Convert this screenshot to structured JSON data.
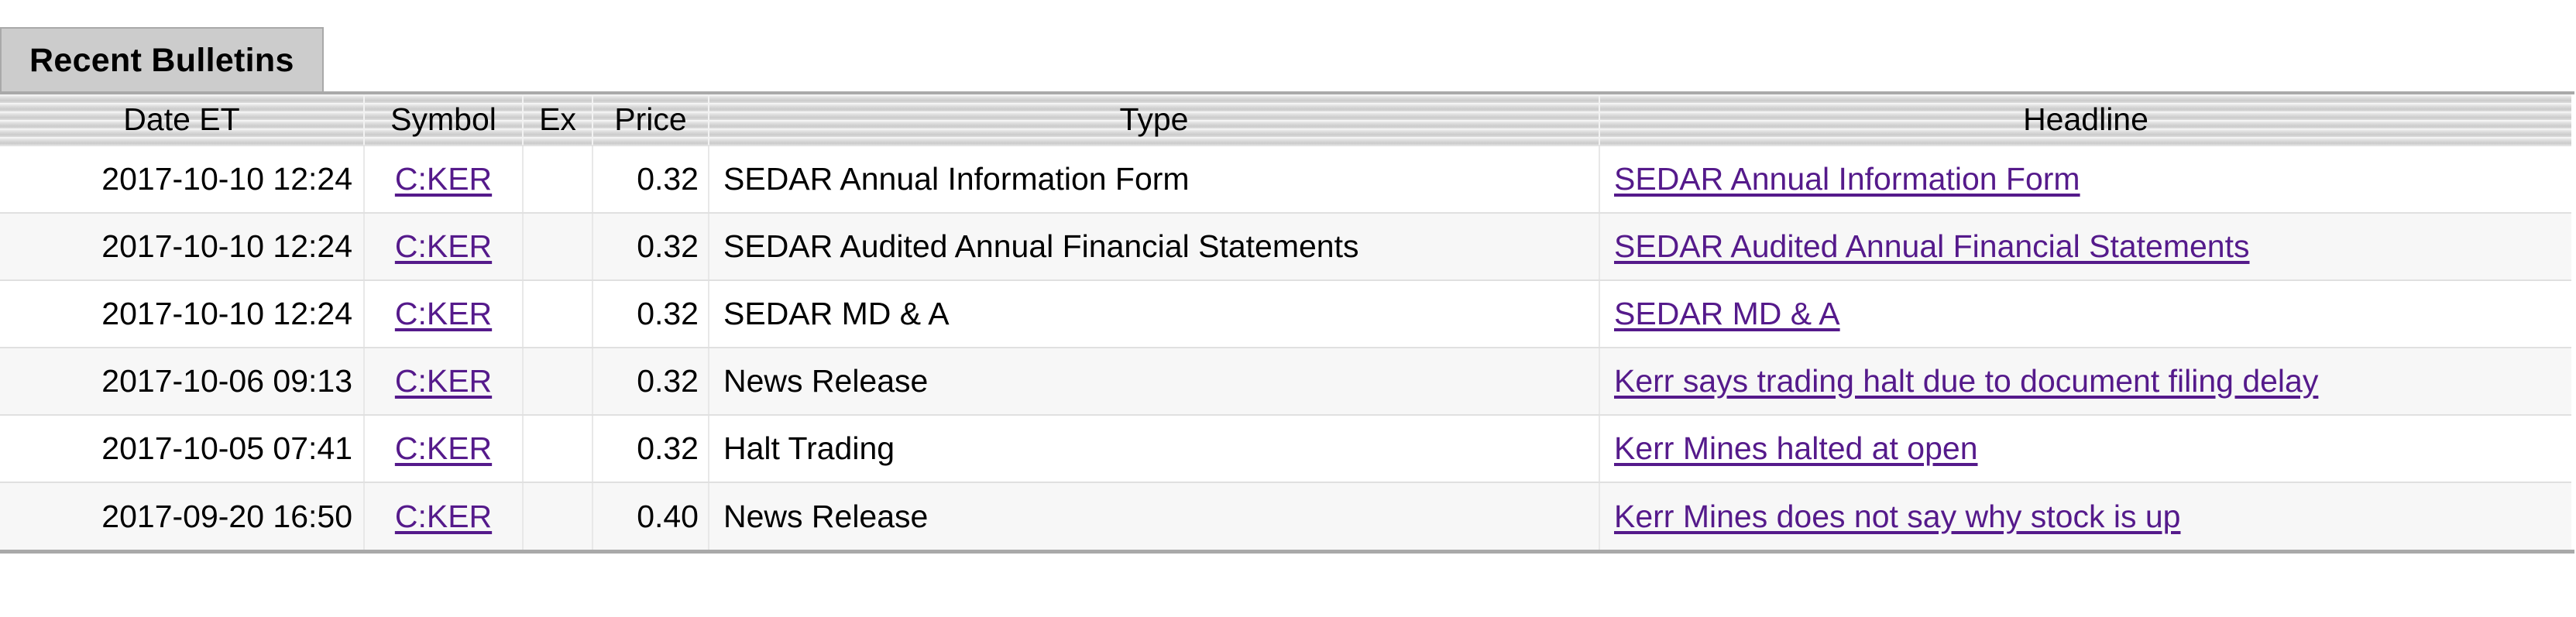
{
  "tabs": [
    {
      "label": "Recent Bulletins",
      "active": true
    }
  ],
  "table": {
    "columns": [
      {
        "key": "date",
        "label": "Date ET"
      },
      {
        "key": "symbol",
        "label": "Symbol"
      },
      {
        "key": "ex",
        "label": "Ex"
      },
      {
        "key": "price",
        "label": "Price"
      },
      {
        "key": "type",
        "label": "Type"
      },
      {
        "key": "headline",
        "label": "Headline"
      }
    ],
    "rows": [
      {
        "date": "2017-10-10 12:24",
        "symbol": "C:KER",
        "ex": "",
        "price": "0.32",
        "type": "SEDAR Annual Information Form",
        "headline": "SEDAR Annual Information Form"
      },
      {
        "date": "2017-10-10 12:24",
        "symbol": "C:KER",
        "ex": "",
        "price": "0.32",
        "type": "SEDAR Audited Annual Financial Statements",
        "headline": "SEDAR Audited Annual Financial Statements"
      },
      {
        "date": "2017-10-10 12:24",
        "symbol": "C:KER",
        "ex": "",
        "price": "0.32",
        "type": "SEDAR MD & A",
        "headline": "SEDAR MD & A"
      },
      {
        "date": "2017-10-06 09:13",
        "symbol": "C:KER",
        "ex": "",
        "price": "0.32",
        "type": "News Release",
        "headline": "Kerr says trading halt due to document filing delay"
      },
      {
        "date": "2017-10-05 07:41",
        "symbol": "C:KER",
        "ex": "",
        "price": "0.32",
        "type": "Halt Trading",
        "headline": "Kerr Mines halted at open"
      },
      {
        "date": "2017-09-20 16:50",
        "symbol": "C:KER",
        "ex": "",
        "price": "0.40",
        "type": "News Release",
        "headline": "Kerr Mines does not say why stock is up"
      }
    ]
  },
  "colors": {
    "link": "#551A8B",
    "tab_background": "#CCCCCC",
    "tab_border": "#A9A9A9",
    "header_background": "#DEDEDE",
    "row_alt_background": "#F7F7F7",
    "text": "#000000"
  }
}
